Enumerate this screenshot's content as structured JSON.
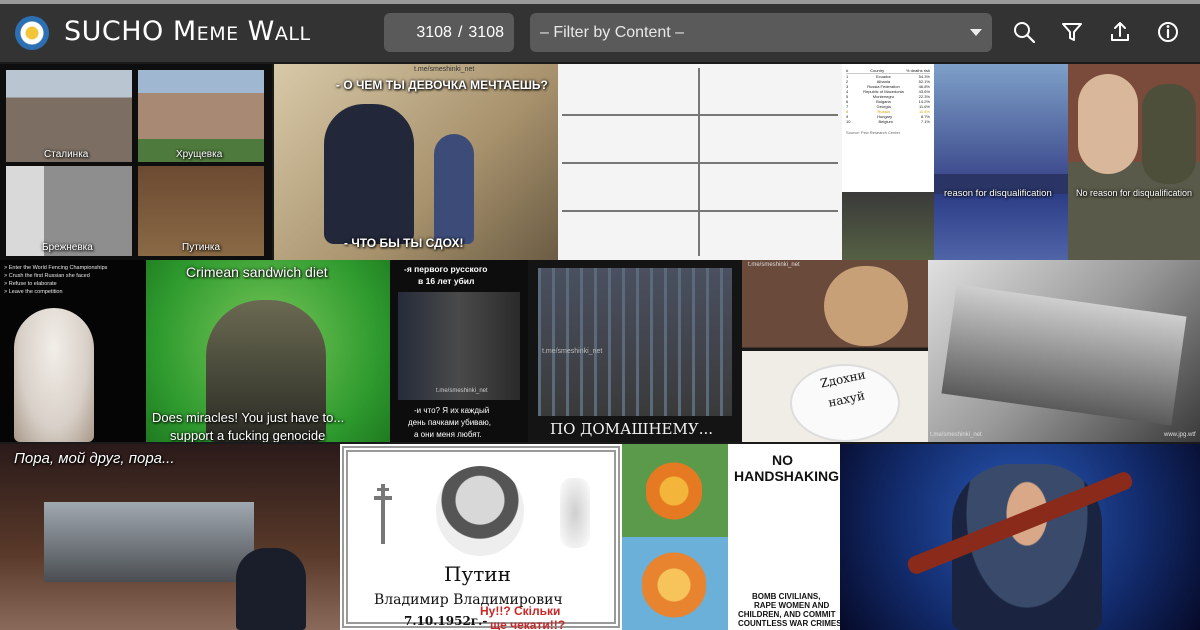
{
  "header": {
    "title": "SUCHO Meme Wall",
    "counter": {
      "current": "3108",
      "separator": "/",
      "total": "3108"
    },
    "filter": {
      "placeholder": "– Filter by Content –"
    },
    "icons": [
      "search-icon",
      "filter-icon",
      "upload-icon",
      "info-icon"
    ]
  },
  "colors": {
    "header_bg": "#333333",
    "control_bg": "#5a5a5a",
    "text": "#ffffff"
  },
  "tiles": {
    "housing": {
      "labels": [
        "Сталинка",
        "Хрущевка",
        "Брежневка",
        "Путинка"
      ]
    },
    "putin_girl": {
      "watermark": "t.me/smeshinki_net",
      "top": "- О ЧЕМ ТЫ ДЕВОЧКА МЕЧТАЕШЬ?",
      "bottom": "- ЧТО БЫ ТЫ СДОХ!"
    },
    "fencing": {
      "left": "reason for disqualification",
      "right": "No reason for disqualification"
    },
    "fencer": {
      "lines": [
        "> Enter the World Fencing Championships",
        "> Crush the first Russian she faced",
        "> Refuse to elaborate",
        "> Leave the competition"
      ]
    },
    "navalny": {
      "top": "Crimean sandwich diet",
      "bottom1": "Does miracles! You just have to...",
      "bottom2": "support a fucking genocide"
    },
    "kadyrov": {
      "top1": "-я первого русского",
      "top2": "в 16 лет убил",
      "watermark": "t.me/smeshinki_net",
      "bottom1": "-и что? Я их каждый",
      "bottom2": "день пачками убиваю,",
      "bottom3": "а они меня любят."
    },
    "prison": {
      "watermark": "t.me/smeshinki_net",
      "caption": "ПО ДОМАШНЕМУ..."
    },
    "birthday": {
      "watermark": "t.me/smeshinki_net",
      "cake_line1": "Zдохни",
      "cake_line2": "нахуй"
    },
    "coffin_black": {
      "watermark": "t.me/smeshinki_net",
      "corner": "www.jpg.wtf"
    },
    "pora": {
      "caption": "Пора, мой друг, пора..."
    },
    "obituary": {
      "name": "Путин",
      "patronymic": "Владимир Владимирович",
      "date": "7.10.1952г.-",
      "overlay1": "Ну!!? Скільки",
      "overlay2": "ще чекати!!?"
    },
    "handshake": {
      "top1": "NO",
      "top2": "HANDSHAKING",
      "bottom1": "BOMB CIVILIANS,",
      "bottom2": "RAPE WOMEN AND",
      "bottom3": "CHILDREN, AND COMMIT",
      "bottom4": "COUNTLESS WAR CRIMES"
    },
    "table": {
      "headers": [
        "#",
        "Country",
        "% deaths risk"
      ],
      "rows": [
        [
          "1",
          "Ecuador",
          "54.3%"
        ],
        [
          "2",
          "Albania",
          "52.1%"
        ],
        [
          "3",
          "Russia Federation",
          "46.8%"
        ],
        [
          "4",
          "Republic of Macedonia",
          "43.6%"
        ],
        [
          "5",
          "Montenegro",
          "22.3%"
        ],
        [
          "6",
          "Bulgaria",
          "14.2%"
        ],
        [
          "7",
          "Georgia",
          "11.6%"
        ],
        [
          "8",
          "Russia",
          "11.4%"
        ],
        [
          "9",
          "Hungary",
          "8.7%"
        ],
        [
          "10",
          "Belgium",
          "7.1%"
        ]
      ],
      "source": "Source: Pew Research Center"
    }
  }
}
